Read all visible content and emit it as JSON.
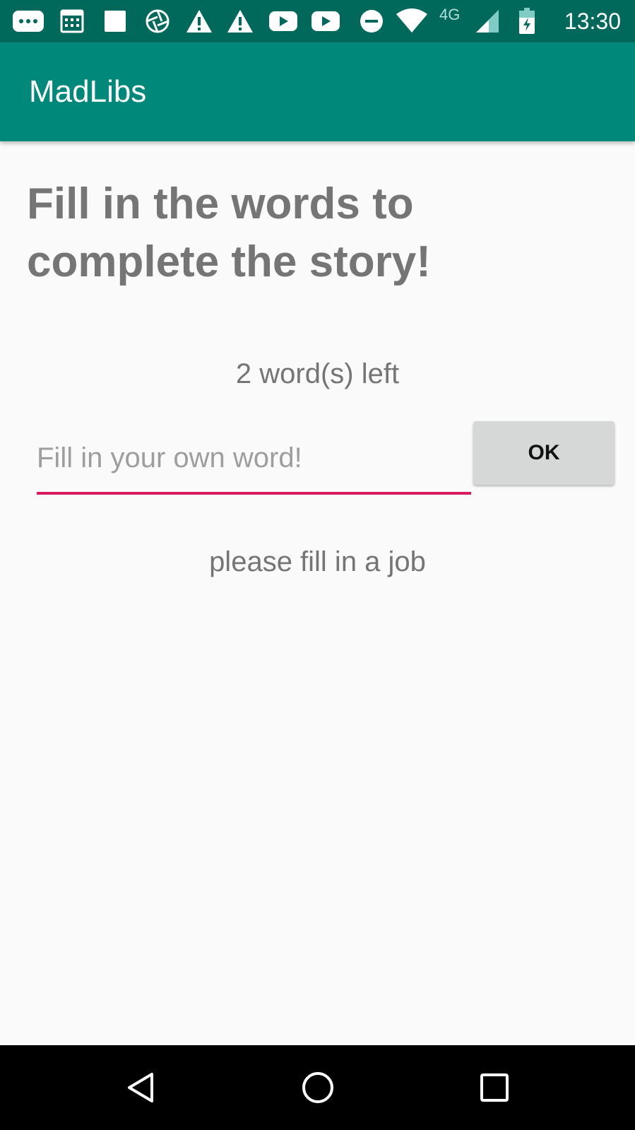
{
  "status_bar": {
    "time": "13:30",
    "network": "4G",
    "icons": [
      "messages-icon",
      "calendar-icon",
      "square-icon",
      "aperture-icon",
      "warning-icon",
      "warning-icon",
      "youtube-icon",
      "youtube-icon",
      "do-not-disturb-icon",
      "wifi-icon",
      "cell-signal-icon",
      "battery-charging-icon"
    ]
  },
  "app_bar": {
    "title": "MadLibs"
  },
  "main": {
    "heading": "Fill in the words to complete the story!",
    "words_left": "2 word(s) left",
    "input": {
      "value": "",
      "placeholder": "Fill in your own word!"
    },
    "ok_label": "OK",
    "hint": "please fill in a job"
  },
  "nav_bar": {
    "icons": [
      "back-icon",
      "home-icon",
      "recents-icon"
    ]
  },
  "colors": {
    "status_bar": "#00695c",
    "app_bar": "#00897b",
    "accent": "#d81b60",
    "text_gray": "#757575",
    "button_gray": "#d6d7d7"
  }
}
